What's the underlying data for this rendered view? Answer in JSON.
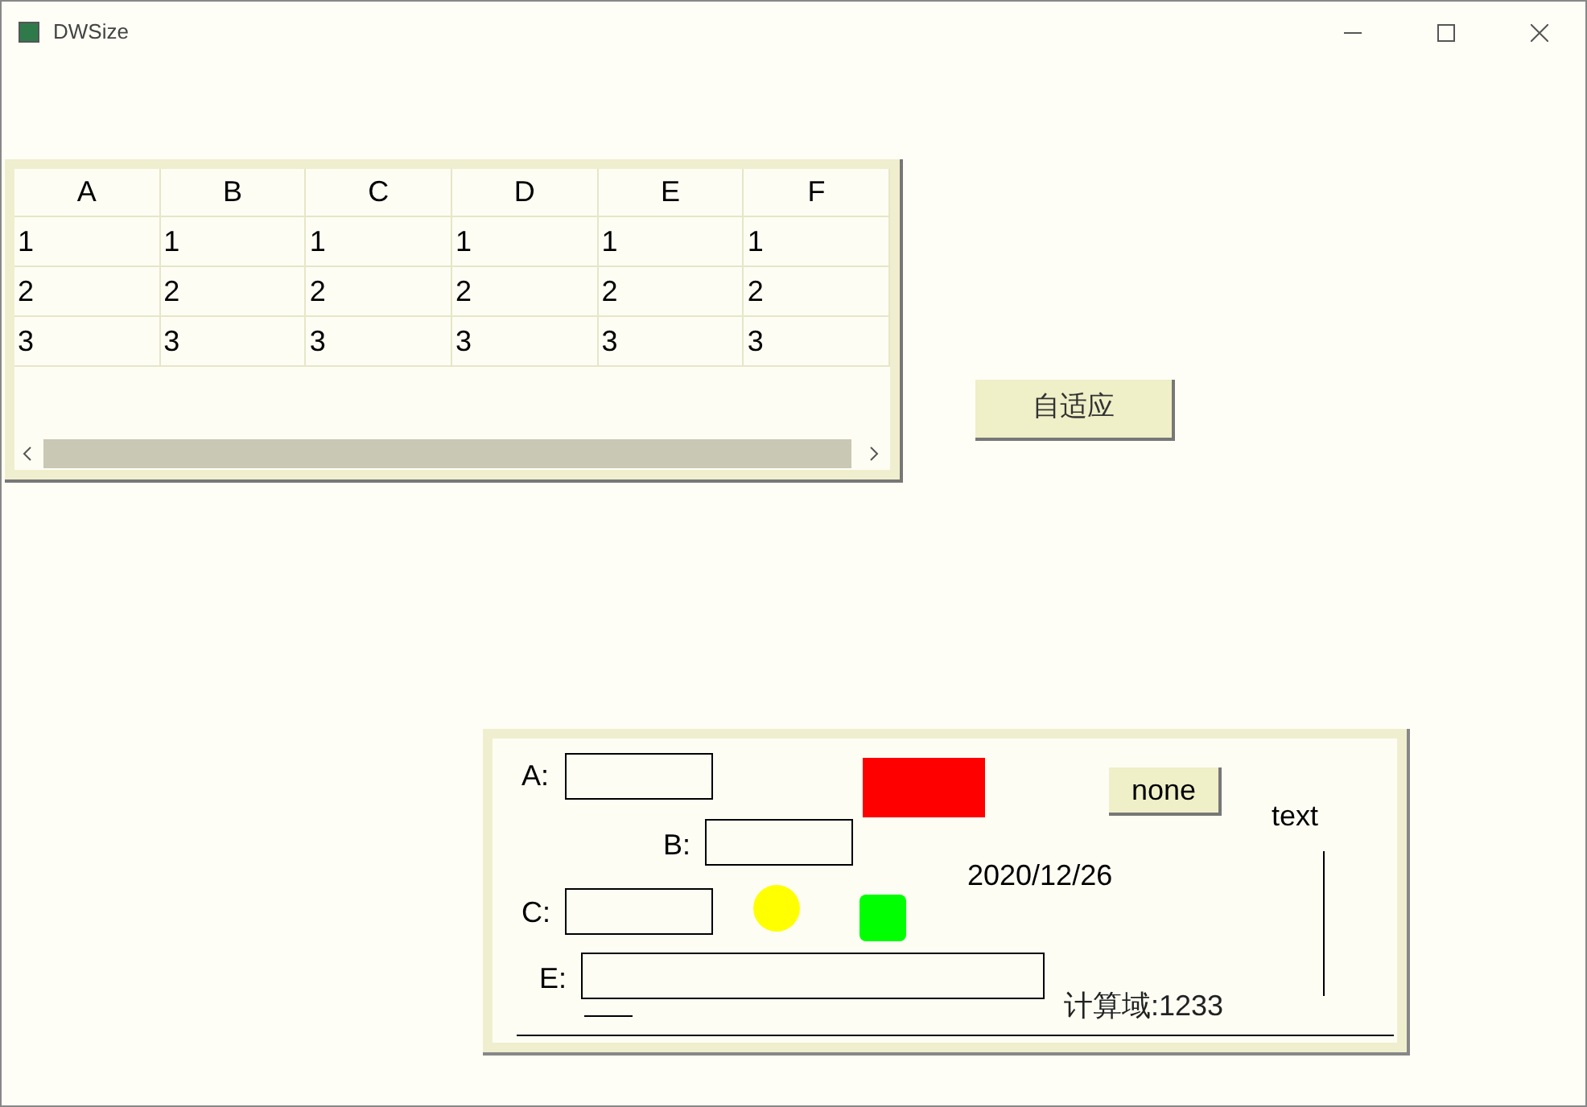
{
  "window": {
    "title": "DWSize"
  },
  "table": {
    "columns": [
      "A",
      "B",
      "C",
      "D",
      "E",
      "F"
    ],
    "rows": [
      [
        "1",
        "1",
        "1",
        "1",
        "1",
        "1"
      ],
      [
        "2",
        "2",
        "2",
        "2",
        "2",
        "2"
      ],
      [
        "3",
        "3",
        "3",
        "3",
        "3",
        "3"
      ]
    ]
  },
  "adapt_button": {
    "label": "自适应"
  },
  "form": {
    "fields": [
      {
        "label": "A:"
      },
      {
        "label": "B:"
      },
      {
        "label": "C:"
      },
      {
        "label": "E:"
      }
    ],
    "shapes": [
      {
        "kind": "rect",
        "color": "#ff0000"
      },
      {
        "kind": "circle",
        "color": "#ffff00"
      },
      {
        "kind": "rounded",
        "color": "#00ff00"
      }
    ],
    "none_button": {
      "label": "none"
    },
    "date": "2020/12/26",
    "text_label": "text",
    "computed": "计算域:1233"
  }
}
